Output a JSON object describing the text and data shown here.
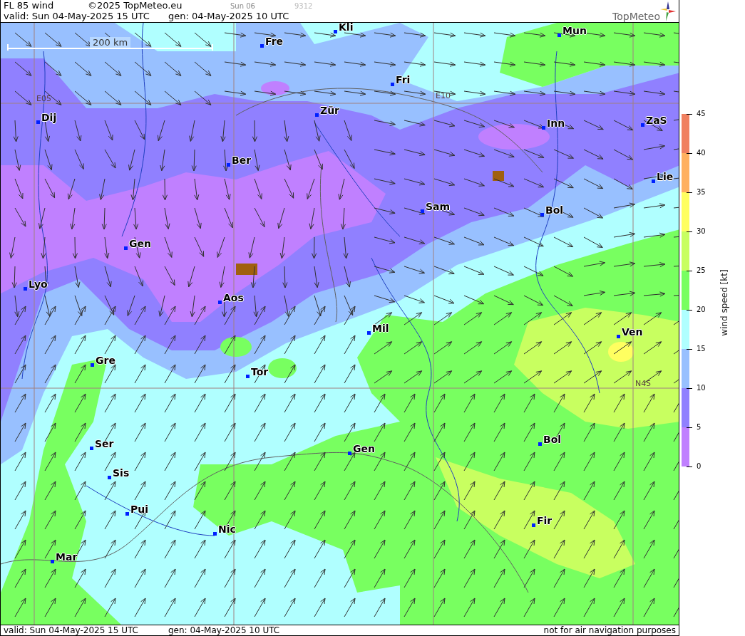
{
  "header": {
    "title": "FL 85 wind",
    "copyright": "©2025 TopMeteo.eu",
    "run_day": "Sun 06",
    "code": "9312",
    "valid": "valid:  Sun  04-May-2025  15 UTC",
    "generated": "gen: 04-May-2025 10 UTC",
    "logo": "TopMeteo"
  },
  "map": {
    "scale": "200 km",
    "grid_labels": [
      "E05",
      "E10",
      "N45"
    ],
    "cities": [
      {
        "name": "Kli"
      },
      {
        "name": "Fre"
      },
      {
        "name": "Mun"
      },
      {
        "name": "Fri"
      },
      {
        "name": "Dij"
      },
      {
        "name": "Zür"
      },
      {
        "name": "Inn"
      },
      {
        "name": "ZaS"
      },
      {
        "name": "Ber"
      },
      {
        "name": "Lie"
      },
      {
        "name": "Sam"
      },
      {
        "name": "Bol"
      },
      {
        "name": "Gen"
      },
      {
        "name": "Lyo"
      },
      {
        "name": "Aos"
      },
      {
        "name": "Mil"
      },
      {
        "name": "Ven"
      },
      {
        "name": "Gre"
      },
      {
        "name": "Tor"
      },
      {
        "name": "Bol"
      },
      {
        "name": "Ser"
      },
      {
        "name": "Gen"
      },
      {
        "name": "Sis"
      },
      {
        "name": "Pui"
      },
      {
        "name": "Fir"
      },
      {
        "name": "Nic"
      },
      {
        "name": "Mar"
      }
    ]
  },
  "legend": {
    "title": "wind speed [kt]",
    "bins": [
      {
        "color": "#f08060"
      },
      {
        "color": "#ffb060"
      },
      {
        "color": "#ffff60"
      },
      {
        "color": "#c8ff60"
      },
      {
        "color": "#78ff60"
      },
      {
        "color": "#b0ffff"
      },
      {
        "color": "#98c0ff"
      },
      {
        "color": "#9080ff"
      },
      {
        "color": "#c080ff"
      }
    ],
    "ticks": [
      "45",
      "40",
      "35",
      "30",
      "25",
      "20",
      "15",
      "10",
      "5",
      "0"
    ]
  },
  "footer": {
    "valid": "valid:  Sun  04-May-2025  15 UTC",
    "generated": "gen: 04-May-2025 10 UTC",
    "disclaimer": "not for air navigation purposes"
  }
}
